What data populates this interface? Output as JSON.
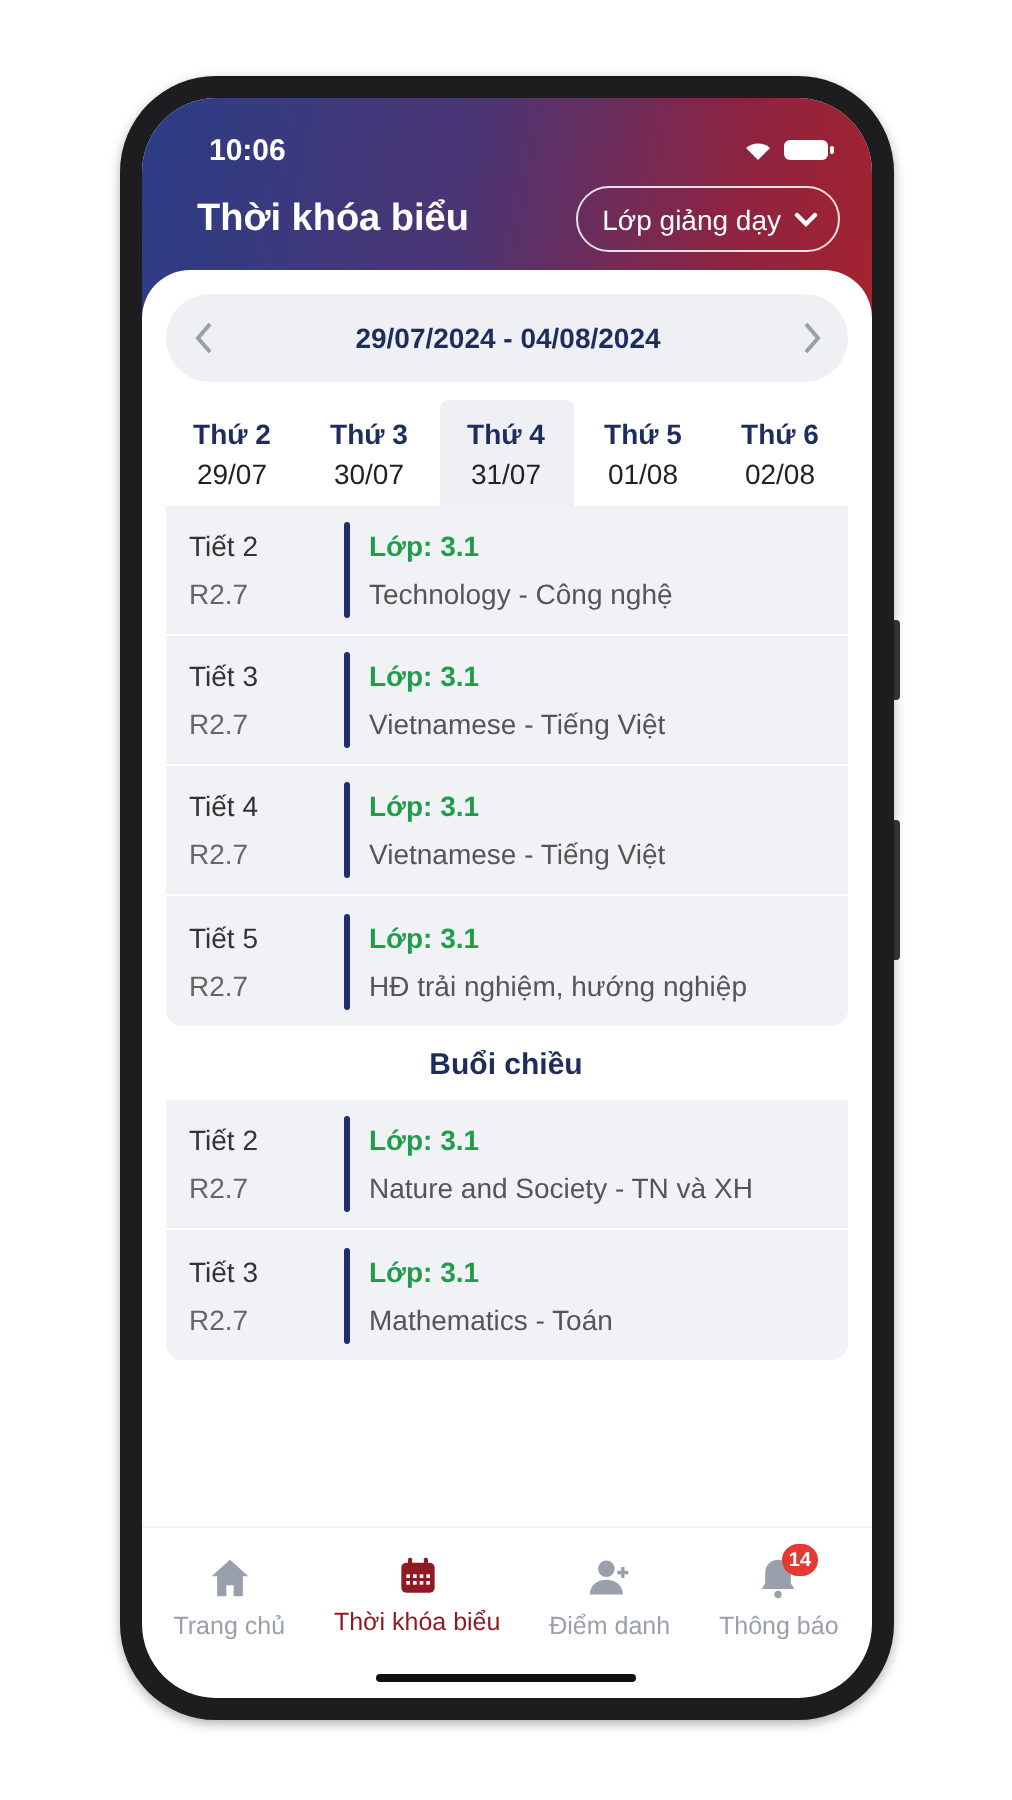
{
  "status_bar": {
    "time": "10:06"
  },
  "header": {
    "title": "Thời khóa biểu",
    "filter_button": "Lớp giảng dạy"
  },
  "week": {
    "range": "29/07/2024 - 04/08/2024"
  },
  "days": [
    {
      "name": "Thứ 2",
      "date": "29/07",
      "selected": false
    },
    {
      "name": "Thứ 3",
      "date": "30/07",
      "selected": false
    },
    {
      "name": "Thứ 4",
      "date": "31/07",
      "selected": true
    },
    {
      "name": "Thứ 5",
      "date": "01/08",
      "selected": false
    },
    {
      "name": "Thứ 6",
      "date": "02/08",
      "selected": false
    }
  ],
  "sections": [
    {
      "lessons": [
        {
          "period": "Tiết 2",
          "room": "R2.7",
          "class": "Lớp: 3.1",
          "subject": "Technology - Công nghệ"
        },
        {
          "period": "Tiết 3",
          "room": "R2.7",
          "class": "Lớp: 3.1",
          "subject": "Vietnamese - Tiếng Việt"
        },
        {
          "period": "Tiết 4",
          "room": "R2.7",
          "class": "Lớp: 3.1",
          "subject": "Vietnamese - Tiếng Việt"
        },
        {
          "period": "Tiết 5",
          "room": "R2.7",
          "class": "Lớp: 3.1",
          "subject": "HĐ trải nghiệm, hướng nghiệp"
        }
      ]
    },
    {
      "title": "Buổi chiều",
      "lessons": [
        {
          "period": "Tiết 2",
          "room": "R2.7",
          "class": "Lớp: 3.1",
          "subject": "Nature and Society - TN và XH"
        },
        {
          "period": "Tiết 3",
          "room": "R2.7",
          "class": "Lớp: 3.1",
          "subject": "Mathematics - Toán"
        }
      ]
    }
  ],
  "nav": [
    {
      "kind": "home",
      "label": "Trang chủ",
      "selected": false
    },
    {
      "kind": "calendar",
      "label": "Thời khóa biểu",
      "selected": true
    },
    {
      "kind": "attendance",
      "label": "Điểm danh",
      "selected": false
    },
    {
      "kind": "bell",
      "label": "Thông báo",
      "selected": false,
      "badge": "14"
    }
  ]
}
